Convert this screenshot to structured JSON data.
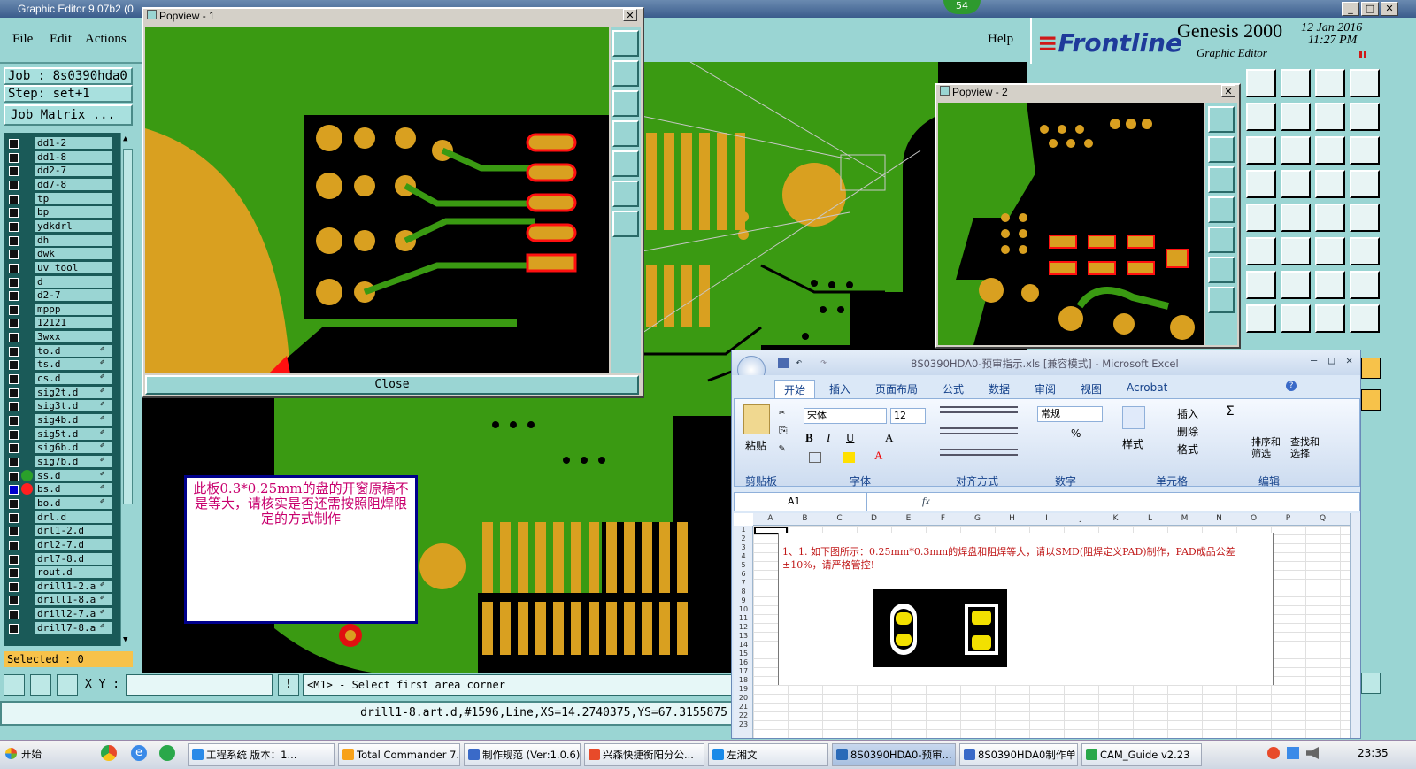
{
  "app": {
    "title": "Graphic Editor 9.07b2 (0",
    "badge": "54",
    "menus": [
      "File",
      "Edit",
      "Actions"
    ],
    "help": "Help",
    "brand": "Frontline",
    "product": "Genesis 2000",
    "subtitle": "Graphic Editor",
    "date": "12 Jan 2016",
    "time": "11:27 PM"
  },
  "left": {
    "job": "Job : 8s0390hda0",
    "step": "Step: set+1",
    "matrix_button": "Job Matrix ...",
    "layers": [
      {
        "name": "dd1-2"
      },
      {
        "name": "dd1-8"
      },
      {
        "name": "dd2-7"
      },
      {
        "name": "dd7-8"
      },
      {
        "name": "tp"
      },
      {
        "name": "bp"
      },
      {
        "name": "ydkdrl"
      },
      {
        "name": "dh"
      },
      {
        "name": "dwk"
      },
      {
        "name": "uv_tool"
      },
      {
        "name": "d"
      },
      {
        "name": "d2-7"
      },
      {
        "name": "mppp"
      },
      {
        "name": "12121"
      },
      {
        "name": "3wxx"
      },
      {
        "name": "to.d",
        "mark": "✐"
      },
      {
        "name": "ts.d",
        "mark": "✐"
      },
      {
        "name": "cs.d",
        "mark": "✐"
      },
      {
        "name": "sig2t.d",
        "mark": "✐"
      },
      {
        "name": "sig3t.d",
        "mark": "✐"
      },
      {
        "name": "sig4b.d",
        "mark": "✐"
      },
      {
        "name": "sig5t.d",
        "mark": "✐"
      },
      {
        "name": "sig6b.d",
        "mark": "✐"
      },
      {
        "name": "sig7b.d",
        "mark": "✐"
      },
      {
        "name": "ss.d",
        "mark": "✐",
        "dot": "#2aa02a"
      },
      {
        "name": "bs.d",
        "mark": "✐",
        "dot": "#ff2020",
        "active": true
      },
      {
        "name": "bo.d",
        "mark": "✐"
      },
      {
        "name": "drl.d"
      },
      {
        "name": "drl1-2.d"
      },
      {
        "name": "drl2-7.d"
      },
      {
        "name": "drl7-8.d"
      },
      {
        "name": "rout.d"
      },
      {
        "name": "drill1-2.a",
        "mark": "✐"
      },
      {
        "name": "drill1-8.a",
        "mark": "✐"
      },
      {
        "name": "drill2-7.a",
        "mark": "✐"
      },
      {
        "name": "drill7-8.a",
        "mark": "✐"
      }
    ],
    "selected": "Selected : 0"
  },
  "popview1": {
    "title": "Popview - 1",
    "close": "Close"
  },
  "popview2": {
    "title": "Popview - 2"
  },
  "note": {
    "text": "此板0.3*0.25mm的盘的开窗原稿不是等大，请核实是否还需按照阻焊限定的方式制作"
  },
  "status": {
    "xy_label": "X Y :",
    "xy_value": "",
    "prompt": "<M1> - Select first area corner",
    "line": "drill1-8.art.d,#1596,Line,XS=14.2740375,YS=67.3155875"
  },
  "excel": {
    "title": "8S0390HDA0-预审指示.xls  [兼容模式] - Microsoft Excel",
    "tabs": [
      "开始",
      "插入",
      "页面布局",
      "公式",
      "数据",
      "审阅",
      "视图",
      "Acrobat"
    ],
    "font_name": "宋体",
    "font_size": "12",
    "number_format": "常规",
    "paste": "粘贴",
    "style": "样式",
    "insert": "插入",
    "delete": "删除",
    "format": "格式",
    "sort": "排序和\n筛选",
    "find": "查找和\n选择",
    "groups": [
      "剪贴板",
      "字体",
      "对齐方式",
      "数字",
      "单元格",
      "编辑"
    ],
    "namebox": "A1",
    "fx": "fx",
    "columns": [
      "A",
      "B",
      "C",
      "D",
      "E",
      "F",
      "G",
      "H",
      "I",
      "J",
      "K",
      "L",
      "M",
      "N",
      "O",
      "P",
      "Q"
    ],
    "rows": [
      "1",
      "2",
      "3",
      "4",
      "5",
      "6",
      "7",
      "8",
      "9",
      "10",
      "11",
      "12",
      "13",
      "14",
      "15",
      "16",
      "17",
      "18",
      "19",
      "20",
      "21",
      "22",
      "23"
    ],
    "note": "1、1. 如下图所示：0.25mm*0.3mm的焊盘和阻焊等大，请以SMD(阻焊定义PAD)制作，PAD成品公差±10%，请严格管控!"
  },
  "taskbar": {
    "start": "开始",
    "items": [
      {
        "label": "工程系统  版本：1..."
      },
      {
        "label": "Total Commander 7...."
      },
      {
        "label": "制作规范 (Ver:1.0.6)"
      },
      {
        "label": "兴森快捷衡阳分公..."
      },
      {
        "label": "左湘文"
      },
      {
        "label": "8S0390HDA0-预审..."
      },
      {
        "label": "8S0390HDA0制作单..."
      },
      {
        "label": "CAM_Guide v2.23"
      }
    ],
    "clock": "23:35"
  }
}
